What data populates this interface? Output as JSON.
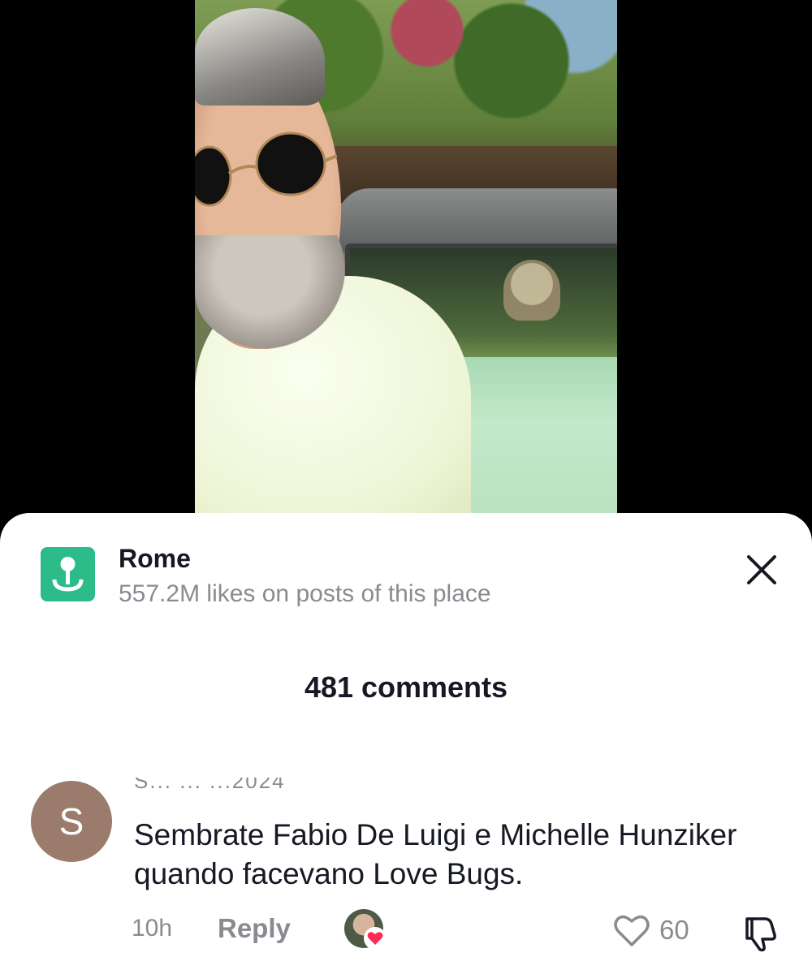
{
  "video": {
    "description_icons": [
      "person-with-sunglasses",
      "green-car"
    ]
  },
  "location": {
    "icon": "location-pin-icon",
    "name": "Rome",
    "subtitle": "557.2M likes on posts of this place",
    "accent": "#2bbc8a"
  },
  "close_icon": "close-icon",
  "comments": {
    "count_label": "481 comments",
    "items": [
      {
        "avatar_initial": "S",
        "username": "S... ... ...2024",
        "text": "Sembrate Fabio De Luigi e Michelle Hunziker quando facevano Love Bugs.",
        "time": "10h",
        "reply_label": "Reply",
        "creator_liked": true,
        "likes": "60"
      }
    ]
  },
  "colors": {
    "text_primary": "#161823",
    "text_secondary": "#8a8b91",
    "avatar_bg": "#9b7b6c",
    "heart": "#fe2c55"
  }
}
